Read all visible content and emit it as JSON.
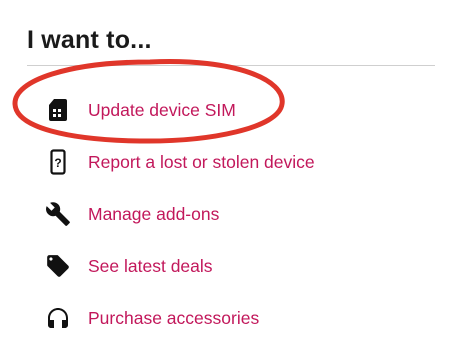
{
  "heading": "I want to...",
  "actions": [
    {
      "label": "Update device SIM",
      "icon": "sim-card-icon"
    },
    {
      "label": "Report a lost or stolen device",
      "icon": "phone-question-icon"
    },
    {
      "label": "Manage add-ons",
      "icon": "wrench-icon"
    },
    {
      "label": "See latest deals",
      "icon": "tag-icon"
    },
    {
      "label": "Purchase accessories",
      "icon": "headphones-icon"
    }
  ],
  "colors": {
    "link": "#c2185b",
    "heading": "#1a1a1a",
    "highlight": "#e0362a",
    "icon": "#111111"
  }
}
